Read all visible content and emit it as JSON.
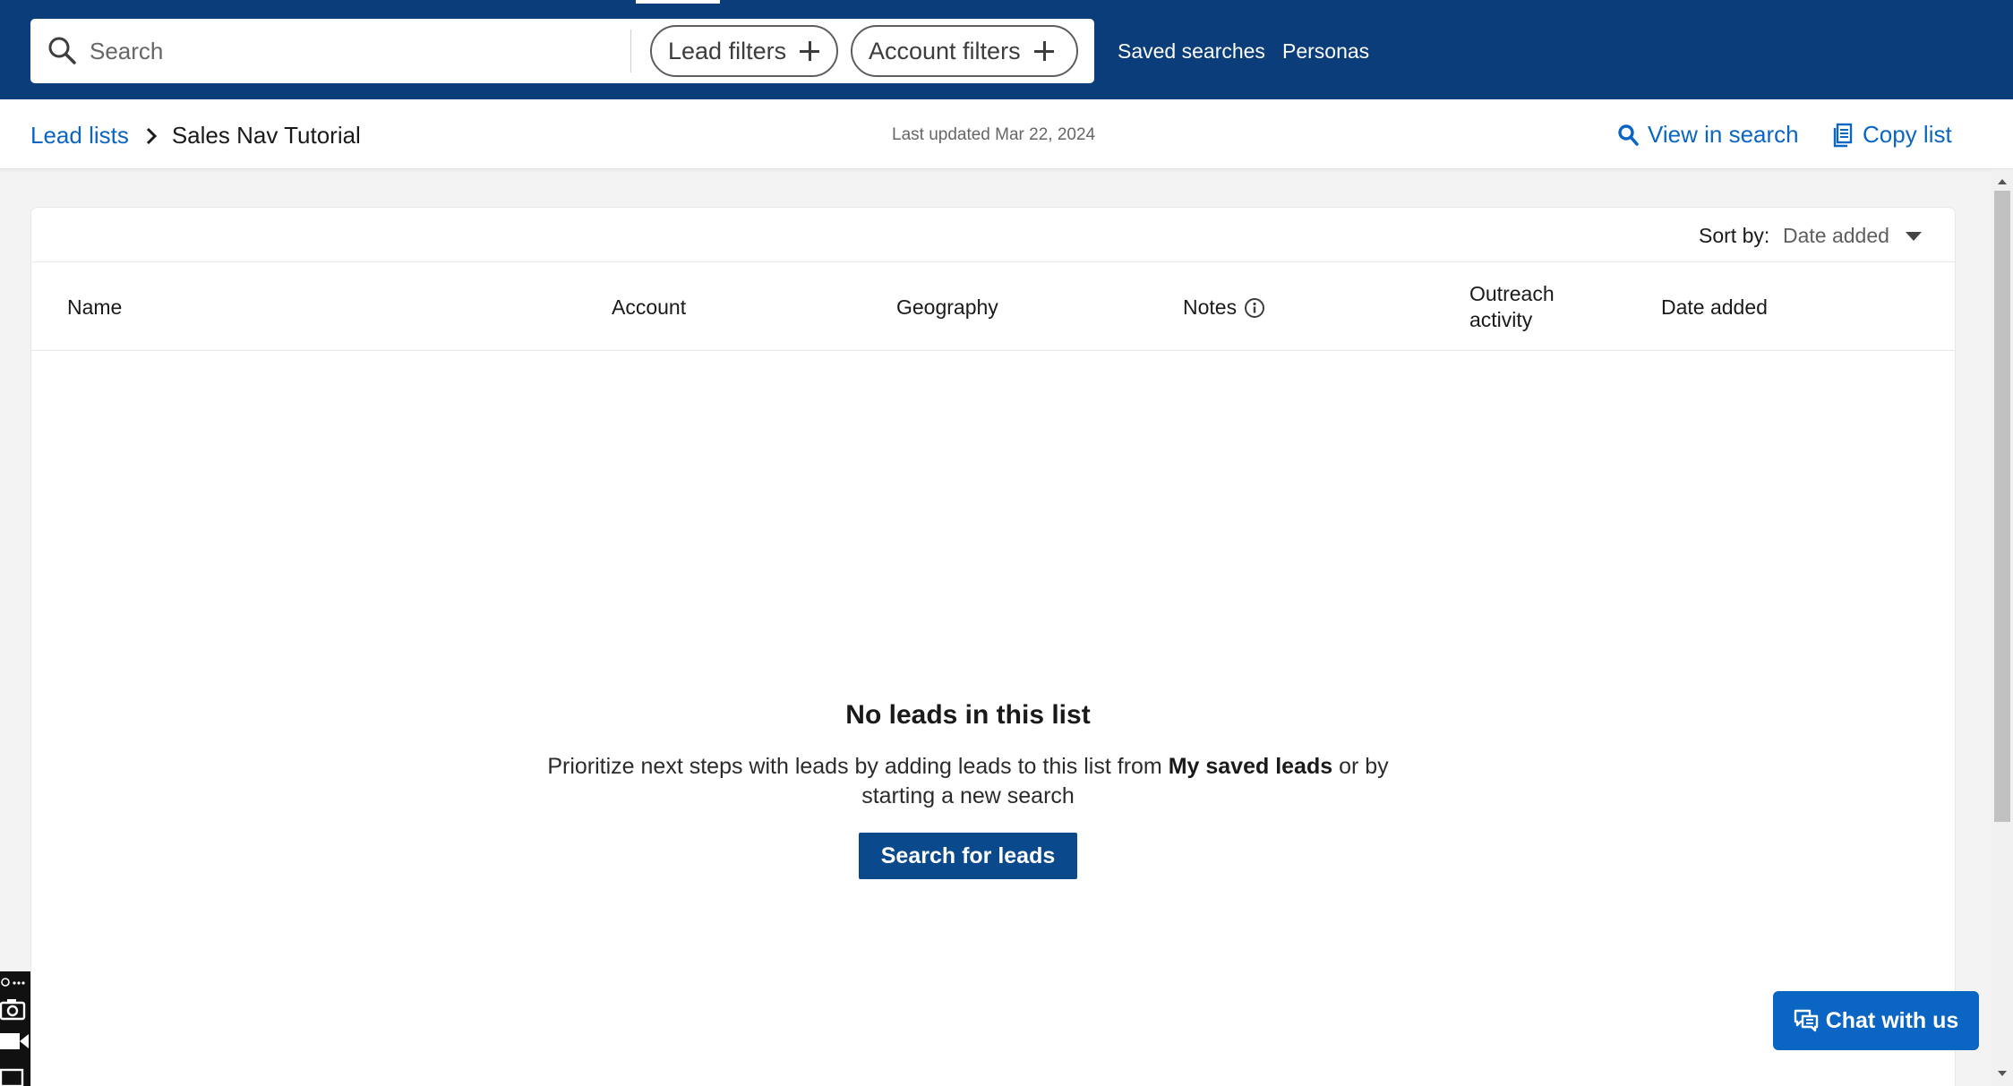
{
  "topnav": {
    "search_placeholder": "Search",
    "lead_filters_label": "Lead filters",
    "account_filters_label": "Account filters",
    "saved_searches_label": "Saved searches",
    "personas_label": "Personas"
  },
  "header": {
    "breadcrumb_root": "Lead lists",
    "breadcrumb_current": "Sales Nav Tutorial",
    "last_updated": "Last updated Mar 22, 2024",
    "view_in_search_label": "View in search",
    "copy_list_label": "Copy list"
  },
  "list": {
    "sort_label": "Sort by:",
    "sort_value": "Date added",
    "columns": {
      "name": "Name",
      "account": "Account",
      "geography": "Geography",
      "notes": "Notes",
      "outreach": "Outreach activity",
      "date_added": "Date added"
    }
  },
  "empty_state": {
    "title": "No leads in this list",
    "description_before": "Prioritize next steps with leads by adding leads to this list from ",
    "description_bold": "My saved leads",
    "description_after": " or by starting a new search",
    "button_label": "Search for leads"
  },
  "chat": {
    "label": "Chat with us"
  },
  "colors": {
    "nav_background": "#0a3d7a",
    "link_blue": "#0a66c2",
    "primary_button": "#0a4a8c"
  },
  "icons": [
    "search-icon",
    "plus-icon",
    "chevron-right-icon",
    "magnifier-icon",
    "document-copy-icon",
    "info-icon",
    "caret-down-icon",
    "chat-bubbles-icon",
    "camera-icon",
    "video-icon"
  ]
}
